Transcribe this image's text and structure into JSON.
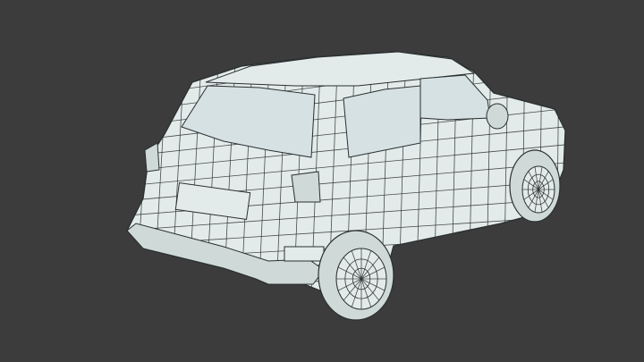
{
  "viewport": {
    "background": "#3c3c3c",
    "model": {
      "subject": "car-wireframe",
      "surface_color": "#e3ebea",
      "shade_color": "#cfd9d8",
      "wire_color": "#2a2f30",
      "glass_color": "#d6e1e3"
    }
  }
}
